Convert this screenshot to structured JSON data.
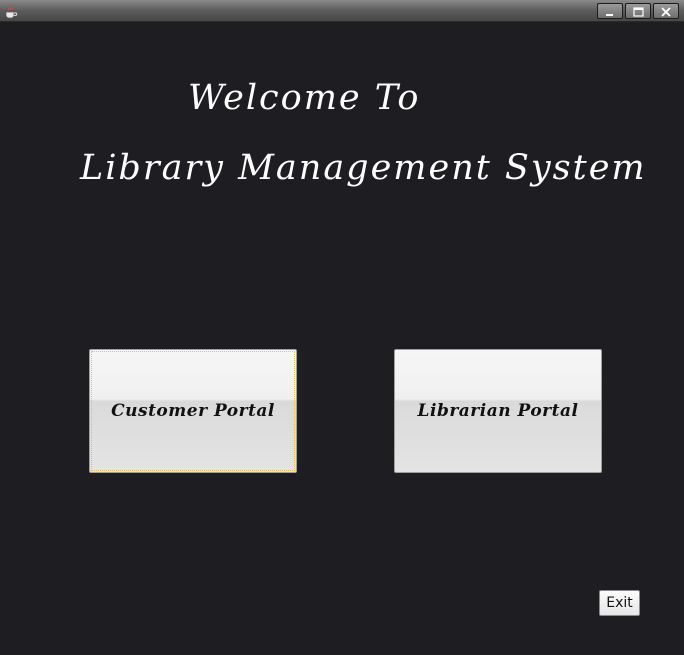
{
  "window": {
    "icon": "java-coffee-icon",
    "controls": {
      "minimize_icon": "minimize-icon",
      "maximize_icon": "maximize-icon",
      "close_icon": "close-icon"
    }
  },
  "main": {
    "welcome_text": "Welcome To",
    "system_title": "Library Management System"
  },
  "buttons": {
    "customer_portal": "Customer Portal",
    "librarian_portal": "Librarian Portal",
    "exit": "Exit"
  },
  "colors": {
    "background": "#1e1d22",
    "title_text": "#ffffff",
    "button_text": "#111111"
  }
}
